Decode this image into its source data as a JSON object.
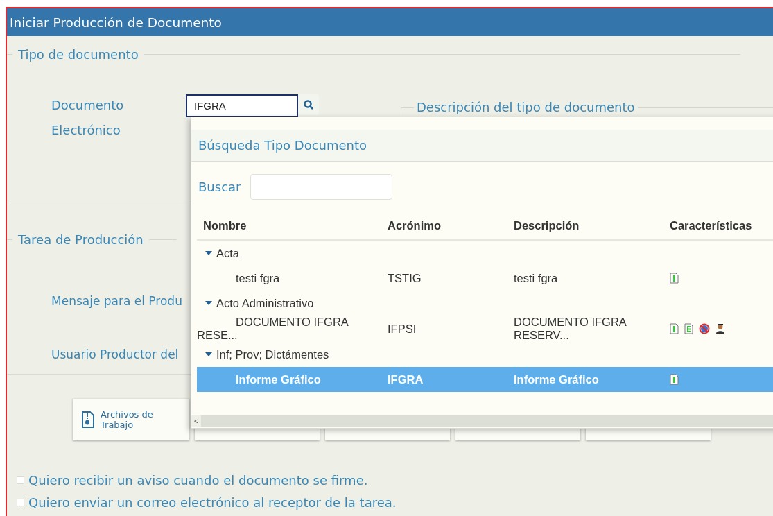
{
  "window": {
    "title": "Iniciar Producción de Documento"
  },
  "tipo_documento": {
    "legend": "Tipo de documento",
    "label_lines": [
      "Documento",
      "Electrónico"
    ],
    "value": "IFGRA",
    "descripcion_legend": "Descripción del tipo de documento"
  },
  "tarea": {
    "legend": "Tarea de Producción",
    "fields": [
      "Mensaje para el Produ",
      "Usuario Productor del"
    ]
  },
  "toolbar": [
    {
      "label_lines": [
        "Archivos de",
        "Trabajo"
      ],
      "kind": "archive"
    },
    {
      "kind": "hidden"
    },
    {
      "kind": "hidden"
    },
    {
      "kind": "hidden"
    },
    {
      "kind": "hidden"
    }
  ],
  "checkboxes": [
    {
      "label": "Quiero recibir un aviso cuando el documento se firme.",
      "checked": false,
      "disabled": true
    },
    {
      "label": "Quiero enviar un correo electrónico al receptor de la tarea.",
      "checked": false,
      "disabled": false
    }
  ],
  "popup": {
    "title": "Búsqueda Tipo Documento",
    "search_label": "Buscar",
    "columns": [
      "Nombre",
      "Acrónimo",
      "Descripción",
      "Características"
    ],
    "groups": [
      {
        "label": "Acta",
        "expanded": true,
        "children": [
          {
            "nombre": "testi fgra",
            "acronimo": "TSTIG",
            "descripcion": "testi fgra",
            "selected": false,
            "features": [
              {
                "kind": "doc-i"
              }
            ]
          }
        ]
      },
      {
        "label": "Acto Administrativo",
        "expanded": true,
        "children": [
          {
            "nombre": "DOCUMENTO IFGRA RESE...",
            "acronimo": "IFPSI",
            "descripcion": "DOCUMENTO IFGRA RESERV...",
            "selected": false,
            "features": [
              {
                "kind": "doc-i"
              },
              {
                "kind": "doc-e"
              },
              {
                "kind": "no-sign"
              },
              {
                "kind": "person"
              }
            ]
          }
        ]
      },
      {
        "label": "Inf; Prov; Dictámentes",
        "expanded": true,
        "children": [
          {
            "nombre": "Informe Gráfico",
            "acronimo": "IFGRA",
            "descripcion": "Informe Gráfico",
            "selected": true,
            "features": [
              {
                "kind": "doc-i"
              }
            ]
          }
        ]
      }
    ],
    "scroll_left": "<"
  }
}
